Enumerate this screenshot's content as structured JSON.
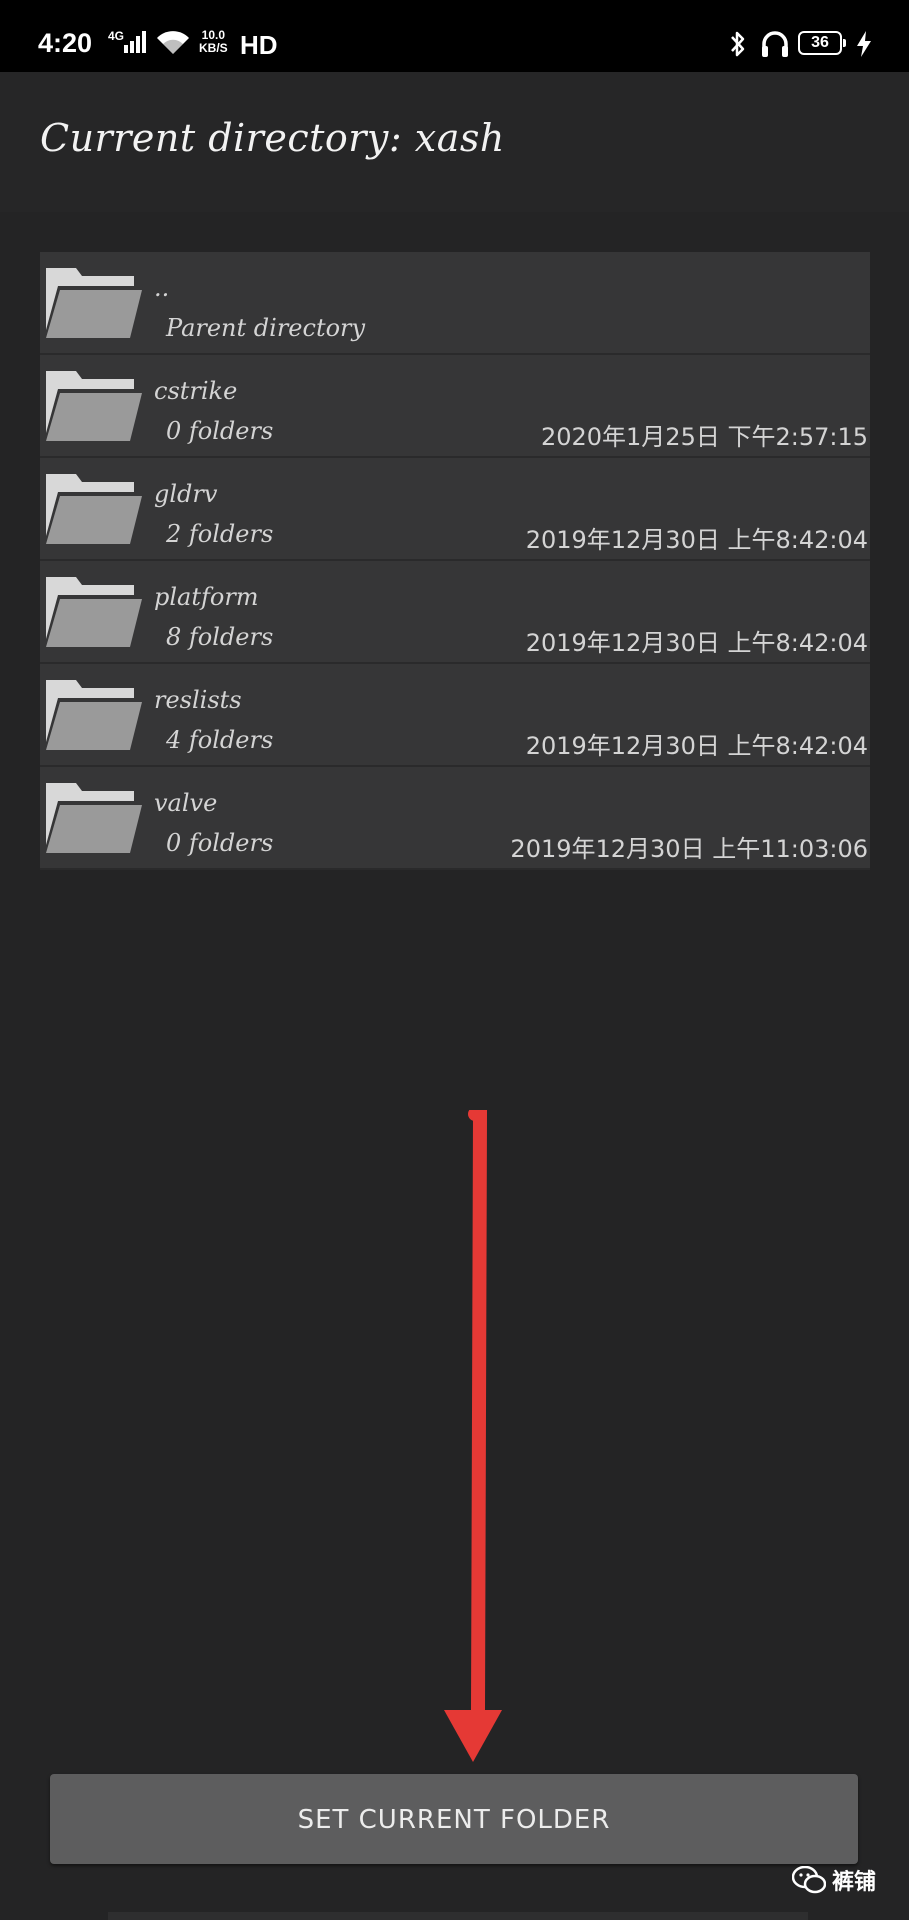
{
  "status_bar": {
    "time": "4:20",
    "network": "4G",
    "speed_value": "10.0",
    "speed_unit": "KB/S",
    "hd": "HD",
    "battery": "36"
  },
  "header": {
    "title": "Current directory: xash"
  },
  "files": [
    {
      "name": "..",
      "info": "Parent directory",
      "date": ""
    },
    {
      "name": "cstrike",
      "info": "0 folders",
      "date": "2020年1月25日 下午2:57:15"
    },
    {
      "name": "gldrv",
      "info": "2 folders",
      "date": "2019年12月30日 上午8:42:04"
    },
    {
      "name": "platform",
      "info": "8 folders",
      "date": "2019年12月30日 上午8:42:04"
    },
    {
      "name": "reslists",
      "info": "4 folders",
      "date": "2019年12月30日 上午8:42:04"
    },
    {
      "name": "valve",
      "info": "0 folders",
      "date": "2019年12月30日 上午11:03:06"
    }
  ],
  "button": {
    "label": "SET CURRENT FOLDER"
  },
  "watermark": {
    "text": "裤铺"
  },
  "colors": {
    "background": "#242425",
    "list_background": "#363637",
    "button_background": "#5d5d5e",
    "folder_icon": "#9a9a9a",
    "annotation_arrow": "#e53935"
  },
  "icons": {
    "folder": "folder-icon",
    "arrow": "red-arrow-annotation",
    "bluetooth": "bluetooth-icon",
    "headset": "headset-icon",
    "wifi": "wifi-icon",
    "signal": "signal-icon",
    "charging": "charging-bolt-icon",
    "wechat": "wechat-icon"
  }
}
